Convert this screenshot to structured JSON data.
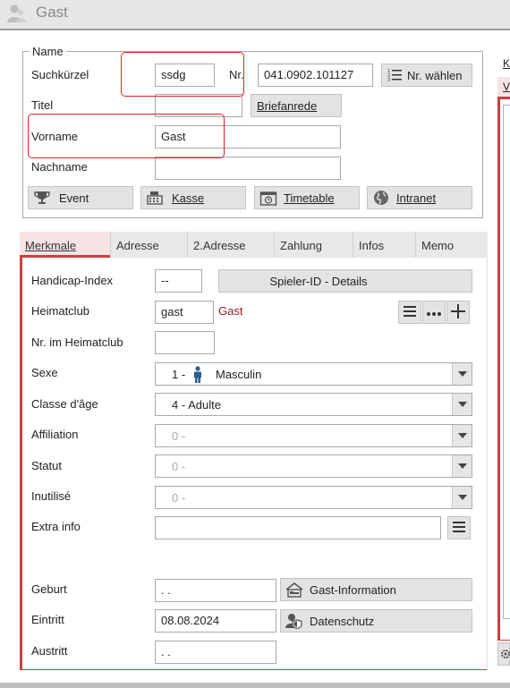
{
  "window": {
    "title": "Gast"
  },
  "name_group": {
    "legend": "Name",
    "suchkuerzel_label": "Suchkürzel",
    "suchkuerzel_value": "ssdg",
    "nr_label": "Nr.",
    "nr_value": "041.0902.101127",
    "nr_waehlen_label": "Nr. wählen",
    "titel_label": "Titel",
    "titel_value": "",
    "briefanrede_label": "Briefanrede",
    "vorname_label": "Vorname",
    "vorname_value": "Gast",
    "nachname_label": "Nachname",
    "nachname_value": ""
  },
  "action_buttons": {
    "event": "Event",
    "kasse": "Kasse",
    "timetable": "Timetable",
    "intranet": "Intranet"
  },
  "tabs": [
    "Merkmale",
    "Adresse",
    "2.Adresse",
    "Zahlung",
    "Infos",
    "Memo"
  ],
  "active_tab": "Merkmale",
  "merkmale": {
    "handicap_label": "Handicap-Index",
    "handicap_value": "--",
    "spieler_id_button": "Spieler-ID - Details",
    "heimatclub_label": "Heimatclub",
    "heimatclub_value": "gast",
    "heimatclub_name": "Gast",
    "nr_heimatclub_label": "Nr. im Heimatclub",
    "nr_heimatclub_value": "",
    "sexe_label": "Sexe",
    "sexe_value_num": "1 -",
    "sexe_value_text": "Masculin",
    "classe_label": "Classe d'âge",
    "classe_value": "4 - Adulte",
    "affiliation_label": "Affiliation",
    "affiliation_value": "0 -",
    "statut_label": "Statut",
    "statut_value": "0 -",
    "inutilise_label": "Inutilisé",
    "inutilise_value": "0 -",
    "extra_label": "Extra info",
    "extra_value": "",
    "geburt_label": "Geburt",
    "geburt_value": ". .",
    "gast_info_button": "Gast-Information",
    "eintritt_label": "Eintritt",
    "eintritt_value": "08.08.2024",
    "datenschutz_button": "Datenschutz",
    "austritt_label": "Austritt",
    "austritt_value": ". ."
  },
  "right_edge": {
    "letter_top": "K",
    "letter_second": "V"
  },
  "colors": {
    "accent_red": "#c94040",
    "highlight_red": "#e02020",
    "club_name": "#a02020",
    "icon_blue": "#2a5d8f"
  }
}
